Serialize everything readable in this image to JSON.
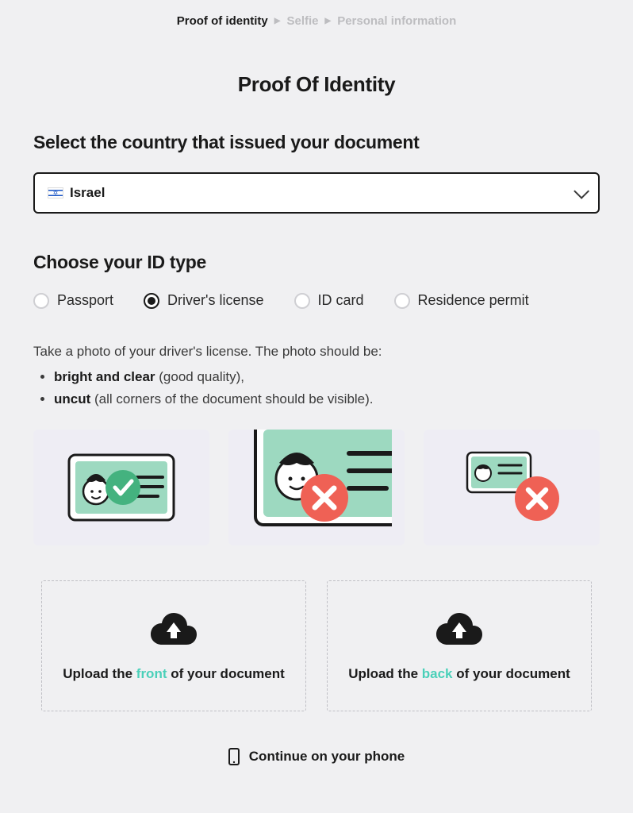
{
  "breadcrumb": {
    "step1": "Proof of identity",
    "step2": "Selfie",
    "step3": "Personal information"
  },
  "title": "Proof Of Identity",
  "country_section": {
    "label": "Select the country that issued your document",
    "selected": "Israel"
  },
  "idtype_section": {
    "label": "Choose your ID type",
    "options": {
      "passport": "Passport",
      "driver": "Driver's license",
      "idcard": "ID card",
      "residence": "Residence permit"
    },
    "selected": "driver"
  },
  "instructions": {
    "lead": "Take a photo of your driver's license. The photo should be:",
    "req1_bold": "bright and clear",
    "req1_rest": " (good quality),",
    "req2_bold": "uncut",
    "req2_rest": " (all corners of the document should be visible)."
  },
  "upload": {
    "front_prefix": "Upload the ",
    "front_hl": "front",
    "front_suffix": " of your document",
    "back_prefix": "Upload the ",
    "back_hl": "back",
    "back_suffix": " of your document"
  },
  "phone_link": "Continue on your phone",
  "colors": {
    "accent_teal": "#4ad0b9",
    "error_red": "#ef6155",
    "card_mint": "#9dd9c0"
  }
}
